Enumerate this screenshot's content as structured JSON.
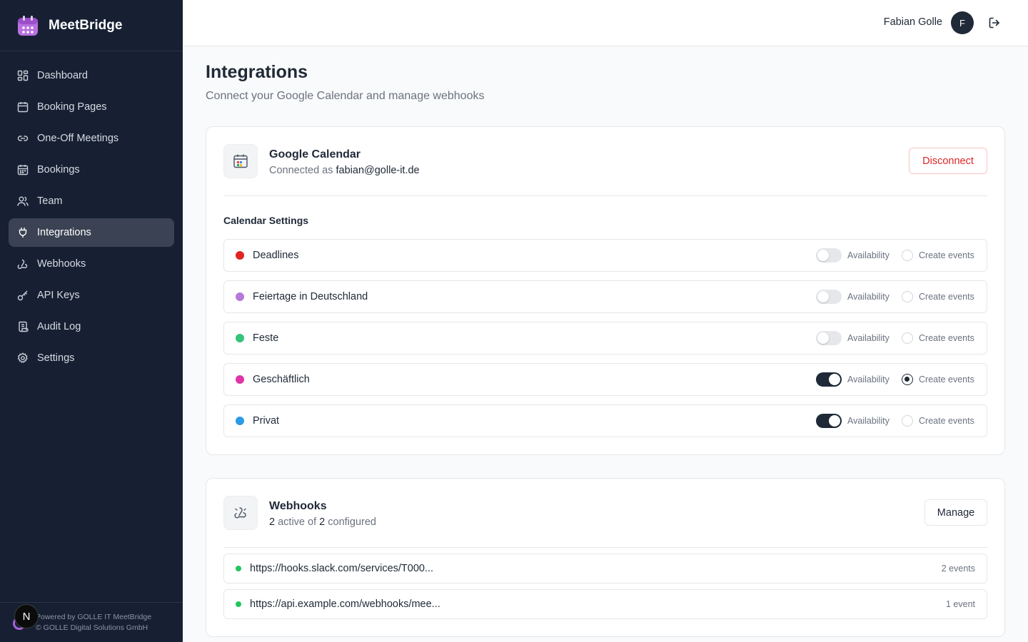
{
  "app": {
    "name": "MeetBridge"
  },
  "sidebar": {
    "items": [
      {
        "label": "Dashboard",
        "icon": "dashboard-icon"
      },
      {
        "label": "Booking Pages",
        "icon": "calendar-icon"
      },
      {
        "label": "One-Off Meetings",
        "icon": "link-icon"
      },
      {
        "label": "Bookings",
        "icon": "calendar-grid-icon"
      },
      {
        "label": "Team",
        "icon": "users-icon"
      },
      {
        "label": "Integrations",
        "icon": "plug-icon",
        "active": true
      },
      {
        "label": "Webhooks",
        "icon": "webhook-icon"
      },
      {
        "label": "API Keys",
        "icon": "key-icon"
      },
      {
        "label": "Audit Log",
        "icon": "scroll-icon"
      },
      {
        "label": "Settings",
        "icon": "gear-icon"
      }
    ],
    "footer": {
      "line1": "Powered by GOLLE IT MeetBridge",
      "line2": "© GOLLE Digital Solutions GmbH",
      "badge": "N"
    }
  },
  "header": {
    "user_name": "Fabian Golle",
    "avatar_initial": "F"
  },
  "page": {
    "title": "Integrations",
    "subtitle": "Connect your Google Calendar and manage webhooks"
  },
  "google_calendar": {
    "title": "Google Calendar",
    "connected_prefix": "Connected as",
    "email": "fabian@golle-it.de",
    "disconnect_label": "Disconnect",
    "settings_label": "Calendar Settings",
    "availability_label": "Availability",
    "create_events_label": "Create events",
    "calendars": [
      {
        "name": "Deadlines",
        "color": "#e02424",
        "availability": false,
        "create_events": false
      },
      {
        "name": "Feiertage in Deutschland",
        "color": "#b57ad9",
        "availability": false,
        "create_events": false
      },
      {
        "name": "Feste",
        "color": "#34c47a",
        "availability": false,
        "create_events": false
      },
      {
        "name": "Geschäftlich",
        "color": "#e034a8",
        "availability": true,
        "create_events": true
      },
      {
        "name": "Privat",
        "color": "#2b9be8",
        "availability": true,
        "create_events": false
      }
    ]
  },
  "webhooks": {
    "title": "Webhooks",
    "active": "2",
    "active_of": "active of",
    "configured": "2",
    "configured_label": "configured",
    "manage_label": "Manage",
    "status_color": "#22c55e",
    "items": [
      {
        "url": "https://hooks.slack.com/services/T000...",
        "events": "2 events"
      },
      {
        "url": "https://api.example.com/webhooks/mee...",
        "events": "1 event"
      }
    ]
  }
}
